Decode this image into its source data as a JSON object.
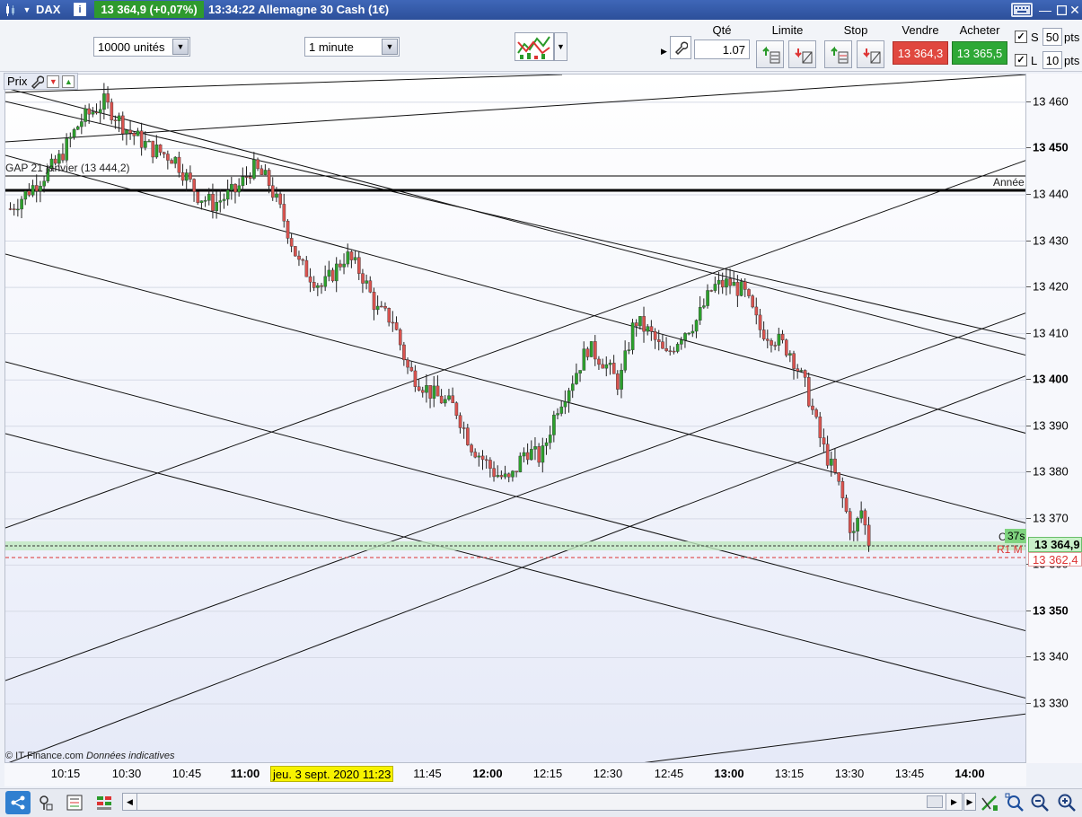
{
  "header": {
    "symbol": "DAX",
    "info": "i",
    "price_badge": "13 364,9 (+0,07%)",
    "time": "13:34:22",
    "instrument": "Allemagne 30 Cash (1€)"
  },
  "toolbar": {
    "units_select": "10000 unités",
    "interval_select": "1 minute",
    "qty_label": "Qté",
    "qty_value": "1.07",
    "limit_label": "Limite",
    "stop_label": "Stop",
    "sell_label": "Vendre",
    "sell_price": "13 364,3",
    "buy_label": "Acheter",
    "buy_price": "13 365,5",
    "s_label": "S",
    "s_value": "50",
    "s_unit": "pts",
    "l_label": "L",
    "l_value": "10",
    "l_unit": "pts"
  },
  "chart": {
    "price_label": "Prix",
    "gap_label": "GAP 21 janvier  (13 444,2)",
    "year_label": "Année",
    "clo_label": "Clo J",
    "timer": "37s",
    "r1_label": "R1 M",
    "last_price_tag": "13 364,9",
    "r1_price_tag": "13 362,4",
    "copyright": "© IT-Finance.com",
    "disclaimer": "Données indicatives",
    "cursor_date": "jeu. 3 sept. 2020 11:23",
    "colors": {
      "up": "#2ca02c",
      "down": "#d9534f",
      "chart_bg": "#ffffff"
    }
  },
  "chart_data": {
    "type": "candlestick",
    "y_ticks": [
      "13 460",
      "13 450",
      "13 440",
      "13 430",
      "13 420",
      "13 410",
      "13 400",
      "13 390",
      "13 380",
      "13 370",
      "13 360",
      "13 350",
      "13 340",
      "13 330"
    ],
    "x_ticks": [
      "10:15",
      "10:30",
      "10:45",
      "11:00",
      "11:45",
      "12:00",
      "12:15",
      "12:30",
      "12:45",
      "13:00",
      "13:15",
      "13:30",
      "13:45",
      "14:00"
    ],
    "ylim": [
      13317,
      13466
    ],
    "xlim_minutes_from_1000": [
      10,
      240
    ],
    "close_path": [
      [
        10.5,
        13437
      ],
      [
        10.8,
        13447
      ],
      [
        10.95,
        13456
      ],
      [
        11.1,
        13460
      ],
      [
        11.25,
        13454
      ],
      [
        11.4,
        13450
      ],
      [
        11.55,
        13448
      ],
      [
        11.7,
        13440
      ],
      [
        11.8,
        13438
      ],
      [
        11.95,
        13441
      ],
      [
        12.05,
        13446
      ],
      [
        12.15,
        13443
      ],
      [
        12.25,
        13435
      ],
      [
        12.35,
        13425
      ],
      [
        12.5,
        13420
      ],
      [
        12.65,
        13427
      ],
      [
        12.75,
        13423
      ],
      [
        12.85,
        13415
      ],
      [
        12.95,
        13413
      ],
      [
        13.05,
        13402
      ],
      [
        13.2,
        13397
      ],
      [
        13.35,
        13394
      ],
      [
        13.45,
        13386
      ],
      [
        13.6,
        13380
      ],
      [
        13.7,
        13378
      ],
      [
        13.8,
        13385
      ],
      [
        13.9,
        13383
      ],
      [
        14.0,
        13394
      ],
      [
        14.1,
        13400
      ],
      [
        14.2,
        13407
      ],
      [
        14.3,
        13404
      ],
      [
        14.4,
        13399
      ],
      [
        14.5,
        13413
      ],
      [
        14.6,
        13410
      ],
      [
        14.7,
        13405
      ],
      [
        14.8,
        13410
      ],
      [
        14.9,
        13413
      ],
      [
        15.0,
        13420
      ],
      [
        15.1,
        13421
      ],
      [
        15.2,
        13419
      ],
      [
        15.3,
        13411
      ],
      [
        15.4,
        13409
      ],
      [
        15.5,
        13406
      ],
      [
        15.6,
        13398
      ],
      [
        15.7,
        13386
      ],
      [
        15.8,
        13378
      ],
      [
        15.9,
        13366
      ],
      [
        15.95,
        13372
      ],
      [
        16.0,
        13365
      ]
    ]
  },
  "bottom": {
    "icons": [
      "share-icon",
      "wizard-icon",
      "list-icon",
      "trading-panel-icon",
      "scroll-left-icon",
      "play-icon",
      "scroll-right-icon",
      "drawing-tool-icon",
      "zoom-select-icon",
      "zoom-out-icon",
      "zoom-in-icon"
    ]
  }
}
